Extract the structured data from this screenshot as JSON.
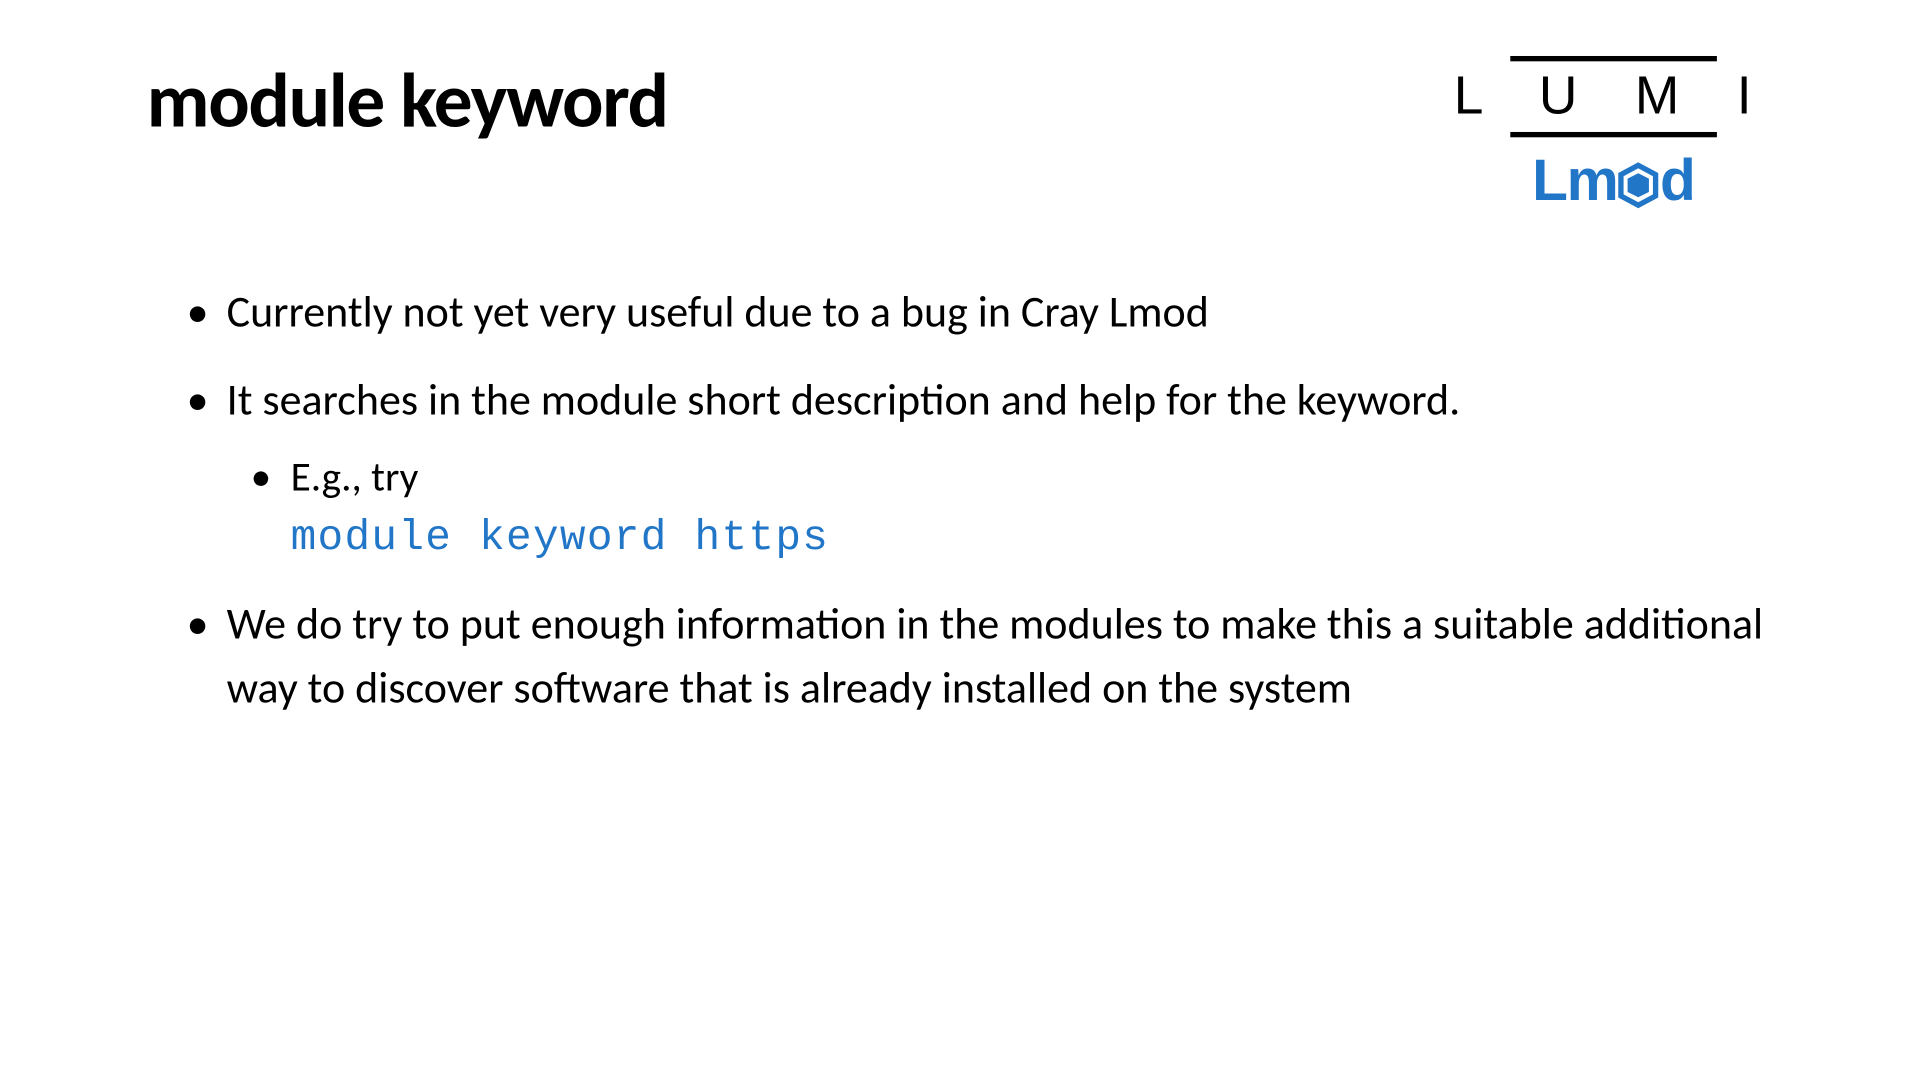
{
  "slide": {
    "title": "module keyword",
    "logo": {
      "lumi": "L U M I",
      "lmod_prefix": "Lm",
      "lmod_suffix": "d"
    },
    "bullets": [
      {
        "text": "Currently not yet very useful due to a bug in Cray Lmod"
      },
      {
        "text": "It searches in the module short description and help for the keyword.",
        "sub": {
          "text": "E.g., try",
          "code": "module keyword https"
        }
      },
      {
        "text": "We do try to put enough information in the modules to make this a suitable additional way to discover software that is already installed on the system"
      }
    ]
  }
}
